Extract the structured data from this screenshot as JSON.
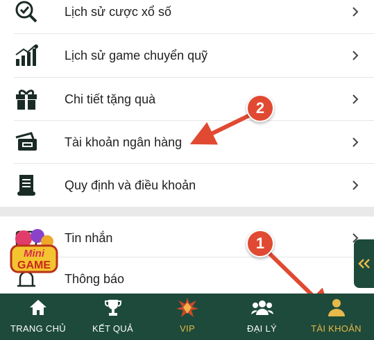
{
  "menu": {
    "items": [
      {
        "label": "Lịch sử cược xổ số",
        "icon": "lottery-history-icon"
      },
      {
        "label": "Lịch sử game chuyển quỹ",
        "icon": "fund-transfer-chart-icon"
      },
      {
        "label": "Chi tiết tặng quà",
        "icon": "gift-icon"
      },
      {
        "label": "Tài khoản ngân hàng",
        "icon": "bank-card-icon"
      },
      {
        "label": "Quy định và điều khoản",
        "icon": "terms-scroll-icon"
      },
      {
        "label": "Tin nhắn",
        "icon": "message-icon"
      },
      {
        "label": "Thông báo",
        "icon": "bell-icon"
      }
    ]
  },
  "overlay": {
    "minigame_line1": "Mini",
    "minigame_line2": "GAME"
  },
  "annotations": {
    "step1": "1",
    "step2": "2"
  },
  "bottom_nav": {
    "tabs": [
      {
        "label": "TRANG CHỦ",
        "icon": "home-icon"
      },
      {
        "label": "KẾT QUẢ",
        "icon": "trophy-icon"
      },
      {
        "label": "VIP",
        "icon": "vip-diamond-icon"
      },
      {
        "label": "ĐẠI LÝ",
        "icon": "users-group-icon"
      },
      {
        "label": "TÀI KHOẢN",
        "icon": "user-account-icon",
        "active": true
      }
    ]
  },
  "colors": {
    "nav_bg": "#1d4a3a",
    "active_tab": "#e7b84a",
    "annotation": "#e14a32"
  }
}
